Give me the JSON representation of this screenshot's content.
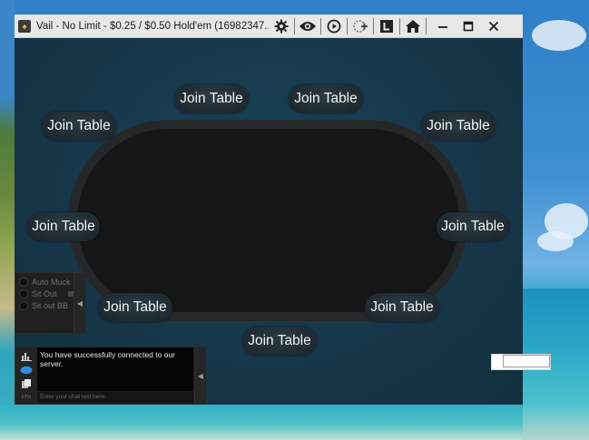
{
  "window": {
    "title": "Vail - No Limit - $0.25 / $0.50 Hold'em (16982347..."
  },
  "toolbar": {
    "icons": [
      "gear-icon",
      "eye-icon",
      "replay-icon",
      "add-table-icon",
      "lobby-l-icon",
      "home-icon"
    ],
    "minimize_glyph": "—",
    "maximize_glyph": "▭",
    "close_glyph": "✕"
  },
  "seats": [
    {
      "label": "Join Table"
    },
    {
      "label": "Join Table"
    },
    {
      "label": "Join Table"
    },
    {
      "label": "Join Table"
    },
    {
      "label": "Join Table"
    },
    {
      "label": "Join Table"
    },
    {
      "label": "Join Table"
    },
    {
      "label": "Join Table"
    },
    {
      "label": "Join Table"
    }
  ],
  "options": {
    "auto_muck": "Auto Muck",
    "sit_out": "Sit Out",
    "sit_out_bb": "Sit out BB"
  },
  "chat": {
    "message": "You have successfully connected to our server.",
    "input_placeholder": "Enter your chat text here.",
    "ftn_label": "FTN"
  },
  "colors": {
    "felt": "#161616",
    "rim": "#252729",
    "background": "#17384a",
    "seat_button": "#1f2a31"
  }
}
